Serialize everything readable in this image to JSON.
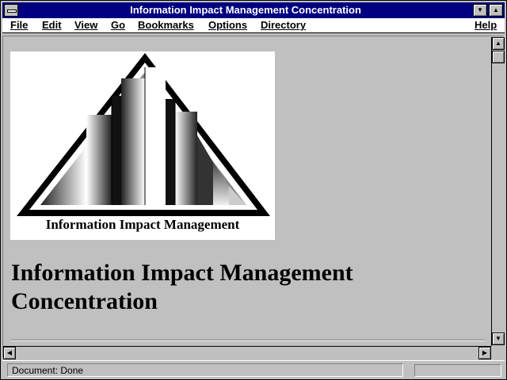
{
  "window": {
    "title": "Information Impact Management Concentration"
  },
  "menu": {
    "items": [
      {
        "label": "File"
      },
      {
        "label": "Edit"
      },
      {
        "label": "View"
      },
      {
        "label": "Go"
      },
      {
        "label": "Bookmarks"
      },
      {
        "label": "Options"
      },
      {
        "label": "Directory"
      },
      {
        "label": "Help"
      }
    ]
  },
  "page": {
    "logo_caption": "Information Impact Management",
    "heading_line1": "Information Impact Management",
    "heading_line2": "Concentration"
  },
  "status": {
    "text": "Document: Done"
  },
  "icons": {
    "system_menu": "system-menu-icon",
    "minimize": "minimize-icon",
    "maximize": "maximize-icon",
    "scroll_up": "arrow-up-icon",
    "scroll_down": "arrow-down-icon",
    "scroll_left": "arrow-left-icon",
    "scroll_right": "arrow-right-icon"
  },
  "colors": {
    "titlebar": "#000080",
    "chrome": "#c0c0c0",
    "desktop": "#008080"
  }
}
